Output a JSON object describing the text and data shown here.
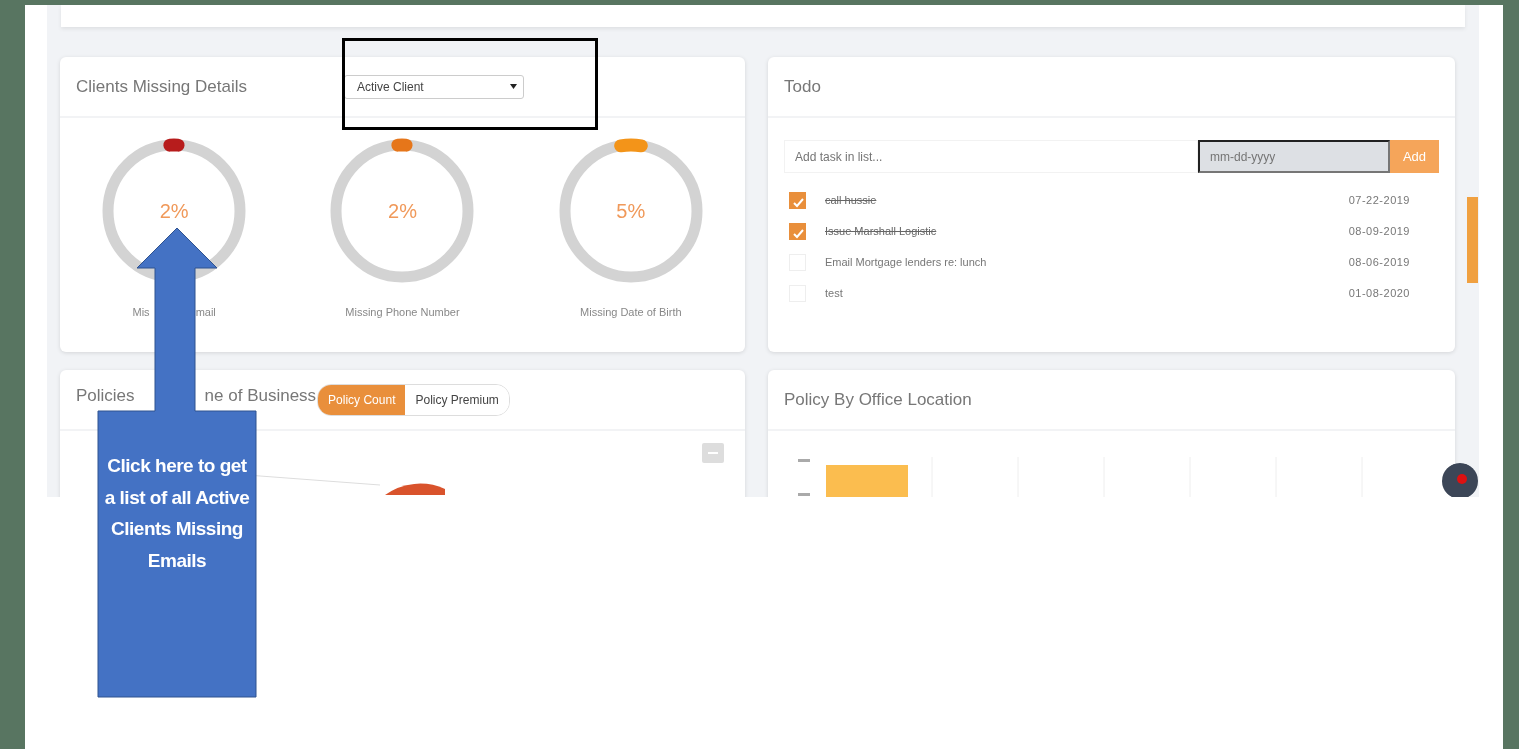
{
  "clients_missing_details": {
    "title": "Clients Missing Details",
    "filter": {
      "value": "Active Client"
    },
    "gauges": [
      {
        "value": "2%",
        "label_parts": [
          "Mis",
          "mail"
        ],
        "level": 0.02,
        "color": "#b71c1c"
      },
      {
        "value": "2%",
        "label": "Missing Phone Number",
        "level": 0.02,
        "color": "#e6761a"
      },
      {
        "value": "5%",
        "label": "Missing Date of Birth",
        "level": 0.05,
        "color": "#f39419"
      }
    ]
  },
  "todo": {
    "title": "Todo",
    "task_placeholder": "Add task in list...",
    "date_placeholder": "mm-dd-yyyy",
    "add_button": "Add",
    "items": [
      {
        "text": "call hussie",
        "date": "07-22-2019",
        "checked": true
      },
      {
        "text": "Issue Marshall Logistic",
        "date": "08-09-2019",
        "checked": true
      },
      {
        "text": "Email Mortgage lenders re: lunch",
        "date": "08-06-2019",
        "checked": false
      },
      {
        "text": "test",
        "date": "01-08-2020",
        "checked": false
      }
    ]
  },
  "policies_by_line": {
    "title_parts": [
      "Policies",
      "ne of Business"
    ],
    "toggle": [
      {
        "label": "Policy Count",
        "selected": true
      },
      {
        "label": "Policy Premium",
        "selected": false
      }
    ]
  },
  "policy_by_office": {
    "title": "Policy By Office Location"
  },
  "callout": {
    "text": "Click here to get a list of all Active Clients Missing Emails"
  }
}
